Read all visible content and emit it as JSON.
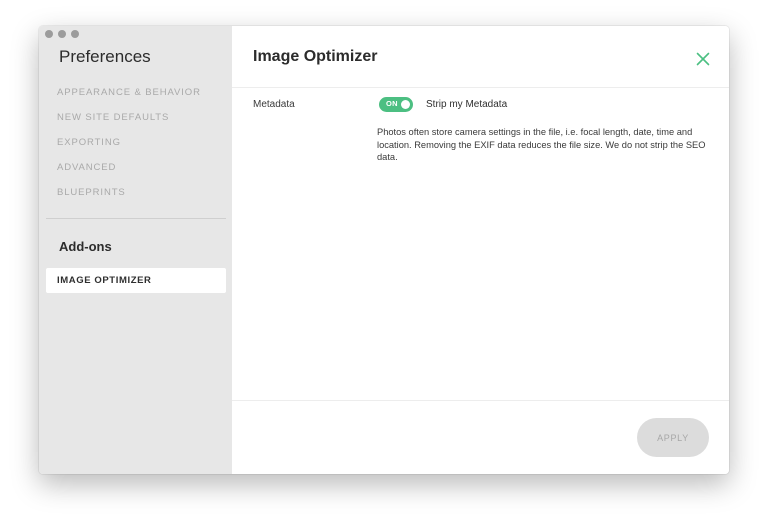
{
  "sidebar": {
    "title": "Preferences",
    "items": [
      {
        "label": "APPEARANCE & BEHAVIOR"
      },
      {
        "label": "NEW SITE DEFAULTS"
      },
      {
        "label": "EXPORTING"
      },
      {
        "label": "ADVANCED"
      },
      {
        "label": "BLUEPRINTS"
      }
    ],
    "addons_title": "Add-ons",
    "addon_items": [
      {
        "label": "IMAGE OPTIMIZER",
        "selected": true
      }
    ]
  },
  "main": {
    "title": "Image Optimizer",
    "close_icon": "close-icon",
    "metadata": {
      "label": "Metadata",
      "toggle_state": "ON",
      "toggle_label": "Strip my Metadata",
      "description": "Photos often store camera settings in the file, i.e. focal length, date, time and location. Removing the EXIF data reduces the file size. We do not strip the SEO data."
    },
    "apply_label": "APPLY"
  },
  "colors": {
    "accent": "#4cbf82",
    "sidebar_bg": "#e7e7e7",
    "close_icon": "#4cbf82",
    "apply_bg": "#dcdcdc"
  }
}
